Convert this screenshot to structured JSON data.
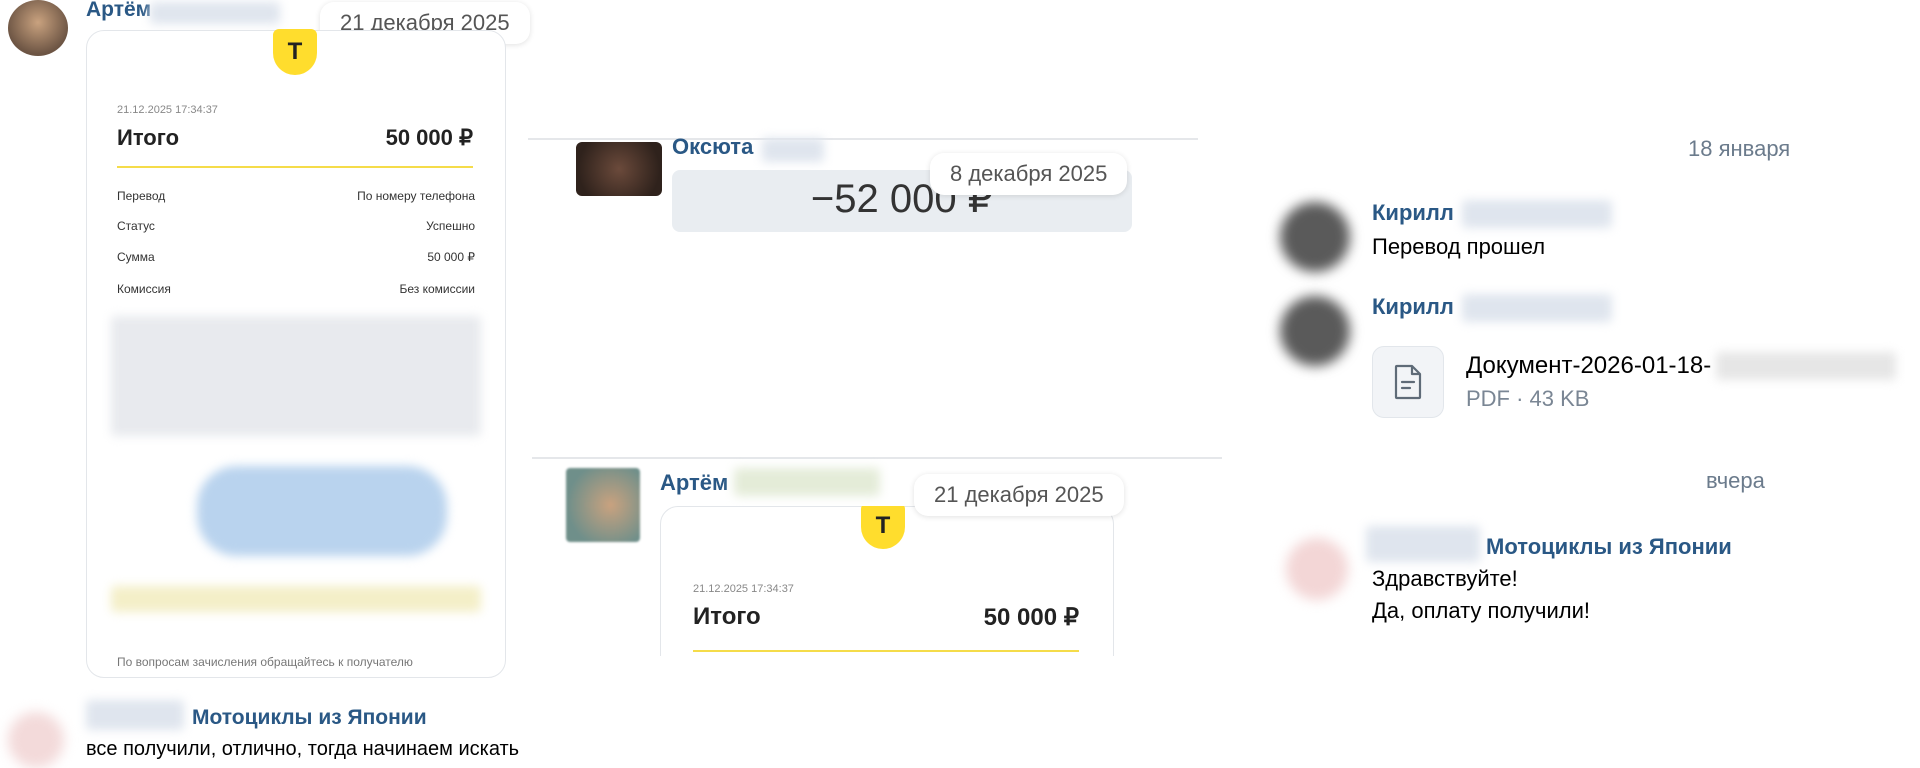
{
  "left": {
    "author_first": "Артём",
    "date_pill": "21 декабря 2025",
    "receipt": {
      "logo_letter": "Т",
      "timestamp": "21.12.2025 17:34:37",
      "total_label": "Итого",
      "total_value": "50 000 ₽",
      "rows": [
        {
          "key": "Перевод",
          "value": "По номеру телефона"
        },
        {
          "key": "Статус",
          "value": "Успешно"
        },
        {
          "key": "Сумма",
          "value": "50 000 ₽"
        },
        {
          "key": "Комиссия",
          "value": "Без комиссии"
        }
      ],
      "footer": "По вопросам зачисления обращайтесь к получателю"
    },
    "bottom_message": {
      "author": "Мотоциклы из Японии",
      "text": "все получили, отлично, тогда начинаем искать"
    }
  },
  "middle": {
    "top": {
      "author_first": "Оксюта",
      "date_pill": "8 декабря 2025",
      "amount": "−52 000 ₽"
    },
    "bottom": {
      "author_first": "Артём",
      "date_pill": "21 декабря 2025",
      "receipt": {
        "logo_letter": "Т",
        "timestamp": "21.12.2025 17:34:37",
        "total_label": "Итого",
        "total_value": "50 000 ₽"
      }
    }
  },
  "right": {
    "date_1": "18 января",
    "msg1": {
      "author": "Кирилл",
      "text": "Перевод прошел"
    },
    "msg2": {
      "author": "Кирилл",
      "file_name": "Документ-2026-01-18-",
      "file_meta": "PDF · 43 KB"
    },
    "date_2": "вчера",
    "msg3": {
      "author": "Мотоциклы из Японии",
      "line1": "Здравствуйте!",
      "line2": "Да, оплату получили!"
    }
  },
  "colors": {
    "accent_link": "#2a5885",
    "bank_yellow": "#ffdd2d"
  }
}
